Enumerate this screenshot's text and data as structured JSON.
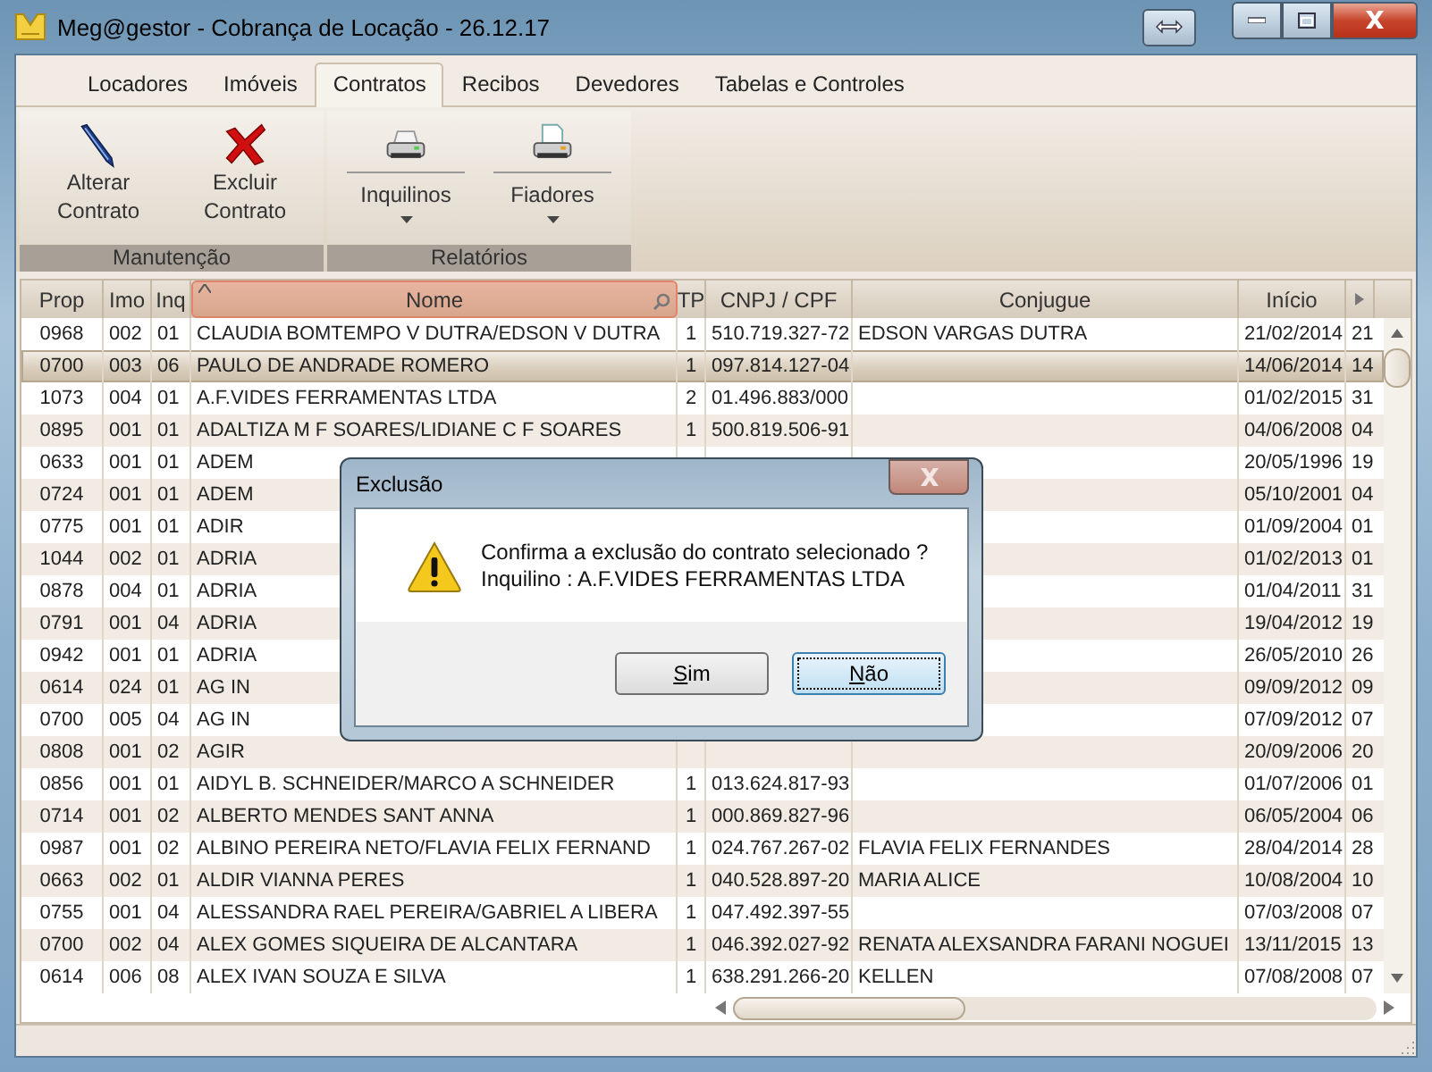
{
  "window": {
    "title": "Meg@gestor - Cobrança de Locação - 26.12.17"
  },
  "tabs": [
    {
      "label": "Locadores",
      "selected": false
    },
    {
      "label": "Imóveis",
      "selected": false
    },
    {
      "label": "Contratos",
      "selected": true
    },
    {
      "label": "Recibos",
      "selected": false
    },
    {
      "label": "Devedores",
      "selected": false
    },
    {
      "label": "Tabelas e Controles",
      "selected": false
    }
  ],
  "ribbon_groups": [
    {
      "label": "Manutenção",
      "buttons": [
        {
          "label": "Alterar Contrato",
          "kind": "pen",
          "dropdown": false
        },
        {
          "label": "Excluir Contrato",
          "kind": "delete",
          "dropdown": false
        }
      ]
    },
    {
      "label": "Relatórios",
      "buttons": [
        {
          "label": "Inquilinos",
          "kind": "printer",
          "dropdown": true
        },
        {
          "label": "Fiadores",
          "kind": "printer-doc",
          "dropdown": true
        }
      ]
    }
  ],
  "table": {
    "columns": [
      {
        "label": "Prop",
        "sorted": false
      },
      {
        "label": "Imo",
        "sorted": false
      },
      {
        "label": "Inq",
        "sorted": false
      },
      {
        "label": "Nome",
        "sorted": true
      },
      {
        "label": "TP",
        "sorted": false
      },
      {
        "label": "CNPJ / CPF",
        "sorted": false
      },
      {
        "label": "Conjugue",
        "sorted": false
      },
      {
        "label": "Início",
        "sorted": false
      },
      {
        "sorted": false
      }
    ],
    "rows": [
      {
        "prop": "0968",
        "imo": "002",
        "inq": "01",
        "nome": "CLAUDIA BOMTEMPO V DUTRA/EDSON V DUTRA",
        "tp": "1",
        "cnpj_cpf": "510.719.327-72",
        "conjugue": "EDSON VARGAS DUTRA",
        "inicio": "21/02/2014",
        "column_9": "21",
        "selected": false
      },
      {
        "prop": "0700",
        "imo": "003",
        "inq": "06",
        "nome": "PAULO DE ANDRADE ROMERO",
        "tp": "1",
        "cnpj_cpf": "097.814.127-04",
        "inicio": "14/06/2014",
        "column_9": "14",
        "selected": true
      },
      {
        "prop": "1073",
        "imo": "004",
        "inq": "01",
        "nome": "A.F.VIDES FERRAMENTAS LTDA",
        "tp": "2",
        "cnpj_cpf": "01.496.883/000",
        "inicio": "01/02/2015",
        "column_9": "31",
        "selected": false
      },
      {
        "prop": "0895",
        "imo": "001",
        "inq": "01",
        "nome": "ADALTIZA M F SOARES/LIDIANE C F SOARES",
        "tp": "1",
        "cnpj_cpf": "500.819.506-91",
        "inicio": "04/06/2008",
        "column_9": "04",
        "selected": false
      },
      {
        "prop": "0633",
        "imo": "001",
        "inq": "01",
        "nome": "ADEM",
        "inicio": "20/05/1996",
        "column_9": "19",
        "selected": false
      },
      {
        "prop": "0724",
        "imo": "001",
        "inq": "01",
        "nome": "ADEM",
        "inicio": "05/10/2001",
        "column_9": "04",
        "selected": false
      },
      {
        "prop": "0775",
        "imo": "001",
        "inq": "01",
        "nome": "ADIR",
        "inicio": "01/09/2004",
        "column_9": "01",
        "selected": false
      },
      {
        "prop": "1044",
        "imo": "002",
        "inq": "01",
        "nome": "ADRIA",
        "inicio": "01/02/2013",
        "column_9": "01",
        "selected": false
      },
      {
        "prop": "0878",
        "imo": "004",
        "inq": "01",
        "nome": "ADRIA",
        "inicio": "01/04/2011",
        "column_9": "31",
        "selected": false
      },
      {
        "prop": "0791",
        "imo": "001",
        "inq": "04",
        "nome": "ADRIA",
        "inicio": "19/04/2012",
        "column_9": "19",
        "selected": false
      },
      {
        "prop": "0942",
        "imo": "001",
        "inq": "01",
        "nome": "ADRIA",
        "inicio": "26/05/2010",
        "column_9": "26",
        "selected": false
      },
      {
        "prop": "0614",
        "imo": "024",
        "inq": "01",
        "nome": "AG IN",
        "inicio": "09/09/2012",
        "column_9": "09",
        "selected": false
      },
      {
        "prop": "0700",
        "imo": "005",
        "inq": "04",
        "nome": "AG IN",
        "inicio": "07/09/2012",
        "column_9": "07",
        "selected": false
      },
      {
        "prop": "0808",
        "imo": "001",
        "inq": "02",
        "nome": "AGIR",
        "inicio": "20/09/2006",
        "column_9": "20",
        "selected": false
      },
      {
        "prop": "0856",
        "imo": "001",
        "inq": "01",
        "nome": "AIDYL B.  SCHNEIDER/MARCO A SCHNEIDER",
        "tp": "1",
        "cnpj_cpf": "013.624.817-93",
        "inicio": "01/07/2006",
        "column_9": "01",
        "selected": false
      },
      {
        "prop": "0714",
        "imo": "001",
        "inq": "02",
        "nome": "ALBERTO MENDES SANT ANNA",
        "tp": "1",
        "cnpj_cpf": "000.869.827-96",
        "inicio": "06/05/2004",
        "column_9": "06",
        "selected": false
      },
      {
        "prop": "0987",
        "imo": "001",
        "inq": "02",
        "nome": "ALBINO PEREIRA NETO/FLAVIA FELIX FERNAND",
        "tp": "1",
        "cnpj_cpf": "024.767.267-02",
        "conjugue": "FLAVIA FELIX FERNANDES",
        "inicio": "28/04/2014",
        "column_9": "28",
        "selected": false
      },
      {
        "prop": "0663",
        "imo": "002",
        "inq": "01",
        "nome": "ALDIR VIANNA PERES",
        "tp": "1",
        "cnpj_cpf": "040.528.897-20",
        "conjugue": "MARIA ALICE",
        "inicio": "10/08/2004",
        "column_9": "10",
        "selected": false
      },
      {
        "prop": "0755",
        "imo": "001",
        "inq": "04",
        "nome": "ALESSANDRA RAEL PEREIRA/GABRIEL A LIBERA",
        "tp": "1",
        "cnpj_cpf": "047.492.397-55",
        "inicio": "07/03/2008",
        "column_9": "07",
        "selected": false
      },
      {
        "prop": "0700",
        "imo": "002",
        "inq": "04",
        "nome": "ALEX GOMES SIQUEIRA DE ALCANTARA",
        "tp": "1",
        "cnpj_cpf": "046.392.027-92",
        "conjugue": "RENATA ALEXSANDRA FARANI NOGUEI",
        "inicio": "13/11/2015",
        "column_9": "13",
        "selected": false
      },
      {
        "prop": "0614",
        "imo": "006",
        "inq": "08",
        "nome": "ALEX IVAN SOUZA E SILVA",
        "tp": "1",
        "cnpj_cpf": "638.291.266-20",
        "conjugue": "KELLEN",
        "inicio": "07/08/2008",
        "column_9": "07",
        "selected": false
      }
    ]
  },
  "dialog": {
    "title": "Exclusão",
    "message_lines": [
      "Confirma a exclusão do contrato selecionado ?",
      "Inquilino : A.F.VIDES FERRAMENTAS LTDA"
    ],
    "buttons": [
      {
        "label": "Sim",
        "focused": false
      },
      {
        "label": "Não",
        "focused": true
      }
    ]
  }
}
